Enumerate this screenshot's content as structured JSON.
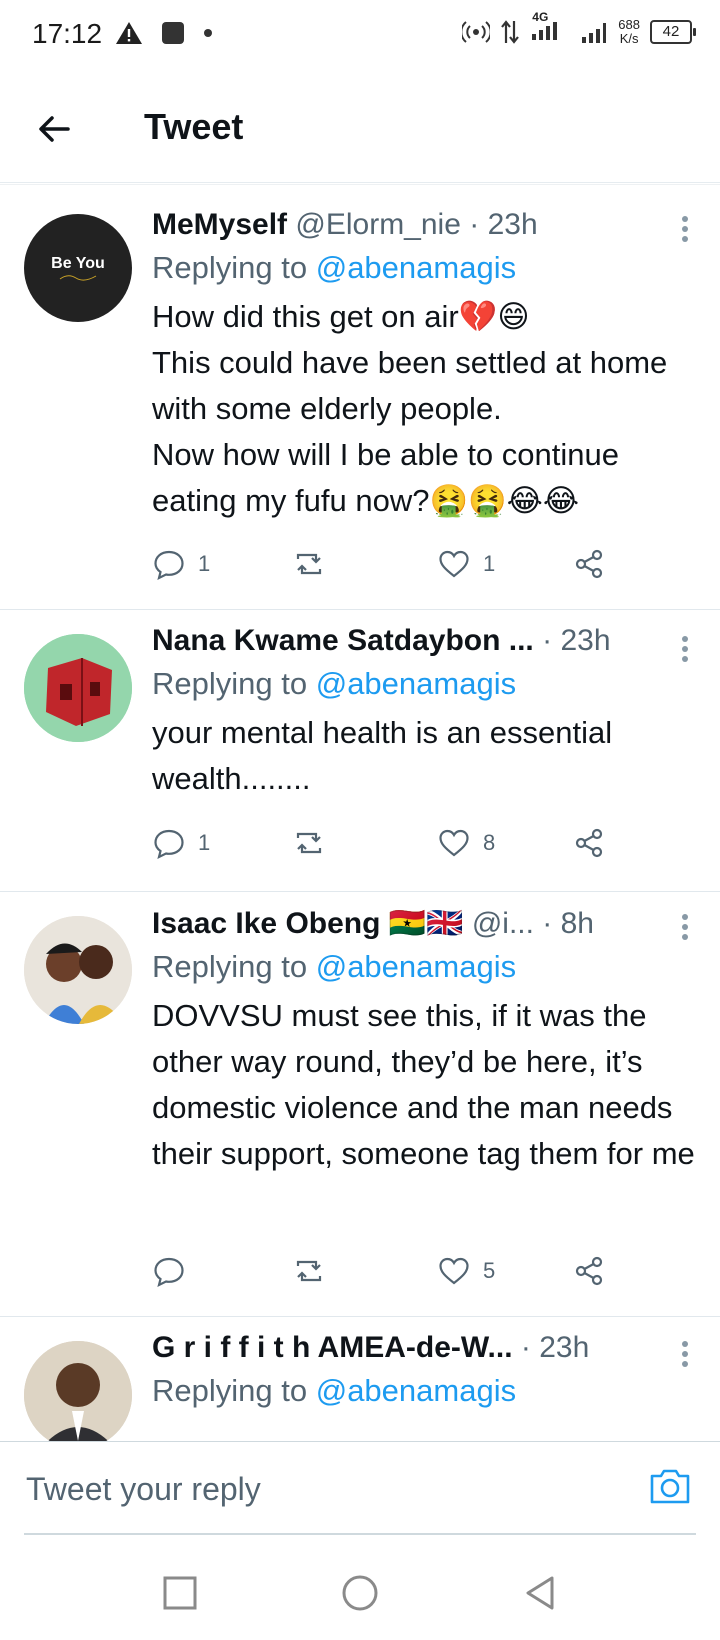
{
  "status_bar": {
    "time": "17:12",
    "network": "4G",
    "speed_value": "688",
    "speed_unit": "K/s",
    "battery": "42"
  },
  "header": {
    "title": "Tweet",
    "back_icon": "arrow-left-icon"
  },
  "tweets": [
    {
      "name": "MeMyself",
      "handle": "@Elorm_nie",
      "time": "· 23h",
      "avatar_text": "Be You",
      "replying_prefix": "Replying to ",
      "replying_to": "@abenamagis",
      "text": "How did this get on air💔😄\nThis could have been settled at home with some elderly people.\nNow how will I be able to continue eating my fufu now?🤮🤮😂😂",
      "replies": "1",
      "retweets": "",
      "likes": "1"
    },
    {
      "name": "Nana Kwame Satdaybon ...",
      "handle": "",
      "time": "· 23h",
      "replying_prefix": "Replying to ",
      "replying_to": "@abenamagis",
      "text": "your mental health is an essential wealth........",
      "replies": "1",
      "retweets": "",
      "likes": "8"
    },
    {
      "name": "Isaac Ike Obeng 🇬🇭🇬🇧",
      "handle": "@i...",
      "time": "· 8h",
      "replying_prefix": "Replying to ",
      "replying_to": "@abenamagis",
      "text": "DOVVSU must see this, if it was the other way round, they’d be here, it’s domestic violence and the man needs their support, someone tag them for me",
      "replies": "",
      "retweets": "",
      "likes": "5"
    },
    {
      "name": "G r i f f i t h AMEA-de-W...",
      "handle": "",
      "time": "· 23h",
      "replying_prefix": "Replying to ",
      "replying_to": "@abenamagis"
    }
  ],
  "reply_bar": {
    "placeholder": "Tweet your reply",
    "camera_icon": "camera-icon"
  },
  "colors": {
    "accent": "#1d9bf0",
    "secondary_text": "#536471",
    "primary_text": "#0f1419"
  }
}
